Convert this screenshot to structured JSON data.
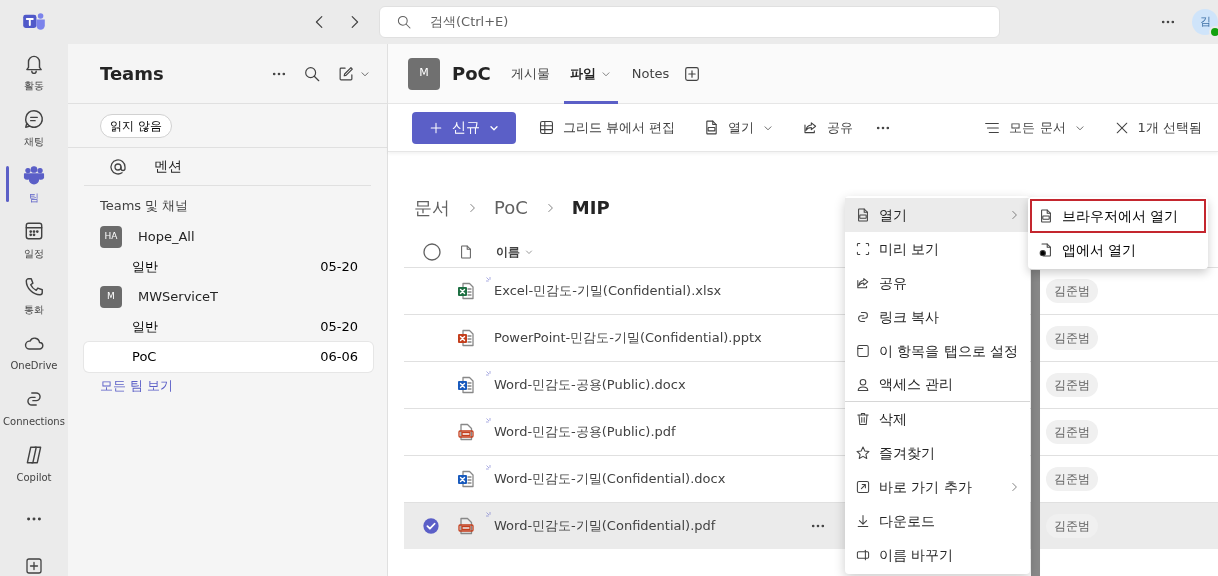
{
  "app_bar": {
    "search_placeholder": "검색(Ctrl+E)",
    "avatar_initial": "김",
    "avatar_online": true
  },
  "rail": [
    {
      "kind": "bell",
      "label": "활동",
      "selected": false
    },
    {
      "kind": "chat",
      "label": "채팅",
      "selected": false
    },
    {
      "kind": "teams",
      "label": "팀",
      "selected": true
    },
    {
      "kind": "calendar",
      "label": "일정",
      "selected": false
    },
    {
      "kind": "phone",
      "label": "통화",
      "selected": false
    },
    {
      "kind": "cloud",
      "label": "OneDrive",
      "selected": false
    },
    {
      "kind": "link",
      "label": "Connections",
      "selected": false
    },
    {
      "kind": "copilot",
      "label": "Copilot",
      "selected": false
    }
  ],
  "teams_panel": {
    "title": "Teams",
    "filter": "읽지 않음",
    "mention": "멘션",
    "section": "Teams 및 채널",
    "teams": [
      {
        "initials": "HA",
        "name": "Hope_All",
        "channels": [
          {
            "name": "일반",
            "date": "05-20",
            "selected": false
          }
        ]
      },
      {
        "initials": "M",
        "name": "MWServiceT",
        "channels": [
          {
            "name": "일반",
            "date": "05-20",
            "selected": false
          },
          {
            "name": "PoC",
            "date": "06-06",
            "selected": true
          }
        ]
      }
    ],
    "see_all": "모든 팀 보기"
  },
  "channel_header": {
    "avatar": "M",
    "name": "PoC",
    "tabs": [
      {
        "label": "게시물",
        "selected": false,
        "dropdown": false
      },
      {
        "label": "파일",
        "selected": true,
        "dropdown": true
      },
      {
        "label": "Notes",
        "selected": false,
        "dropdown": false
      }
    ]
  },
  "toolbar": {
    "new_button": "신규",
    "actions": [
      {
        "kind": "grid",
        "label": "그리드 뷰에서 편집",
        "dropdown": false
      },
      {
        "kind": "file",
        "label": "열기",
        "dropdown": true
      },
      {
        "kind": "share",
        "label": "공유",
        "dropdown": false
      }
    ],
    "view": "모든 문서",
    "selection": "1개 선택됨"
  },
  "breadcrumb": [
    "문서",
    "PoC",
    "MIP"
  ],
  "table": {
    "all_selected": false,
    "name_column": "이름",
    "rows": [
      {
        "kind": "xlsx",
        "name": "Excel-민감도-기밀(Confidential).xlsx",
        "new": true,
        "selected": false,
        "modified_by": "김준범"
      },
      {
        "kind": "pptx",
        "name": "PowerPoint-민감도-기밀(Confidential).pptx",
        "new": false,
        "selected": false,
        "modified_by": "김준범"
      },
      {
        "kind": "docx",
        "name": "Word-민감도-공용(Public).docx",
        "new": true,
        "selected": false,
        "modified_by": "김준범"
      },
      {
        "kind": "pdf",
        "name": "Word-민감도-공용(Public).pdf",
        "new": true,
        "selected": false,
        "modified_by": "김준범"
      },
      {
        "kind": "docx",
        "name": "Word-민감도-기밀(Confidential).docx",
        "new": true,
        "selected": false,
        "modified_by": "김준범"
      },
      {
        "kind": "pdf",
        "name": "Word-민감도-기밀(Confidential).pdf",
        "new": true,
        "selected": true,
        "modified_by": "김준범"
      }
    ]
  },
  "context_menu": {
    "items": [
      {
        "kind": "file",
        "label": "열기",
        "submenu": true,
        "highlighted": true,
        "separator_after": false
      },
      {
        "kind": "preview",
        "label": "미리 보기",
        "submenu": false,
        "highlighted": false,
        "separator_after": false
      },
      {
        "kind": "share",
        "label": "공유",
        "submenu": false,
        "highlighted": false,
        "separator_after": false
      },
      {
        "kind": "link",
        "label": "링크 복사",
        "submenu": false,
        "highlighted": false,
        "separator_after": false
      },
      {
        "kind": "tab",
        "label": "이 항목을 탭으로 설정",
        "submenu": false,
        "highlighted": false,
        "separator_after": false
      },
      {
        "kind": "person",
        "label": "액세스 관리",
        "submenu": false,
        "highlighted": false,
        "separator_after": true
      },
      {
        "kind": "trash",
        "label": "삭제",
        "submenu": false,
        "highlighted": false,
        "separator_after": false
      },
      {
        "kind": "star",
        "label": "즐겨찾기",
        "submenu": false,
        "highlighted": false,
        "separator_after": false
      },
      {
        "kind": "shortcut",
        "label": "바로 가기 추가",
        "submenu": true,
        "highlighted": false,
        "separator_after": false
      },
      {
        "kind": "download",
        "label": "다운로드",
        "submenu": false,
        "highlighted": false,
        "separator_after": false
      },
      {
        "kind": "rename",
        "label": "이름 바꾸기",
        "submenu": false,
        "highlighted": false,
        "separator_after": false
      }
    ],
    "submenu": [
      {
        "kind": "file",
        "label": "브라우저에서 열기",
        "highlighted": true
      },
      {
        "kind": "app",
        "label": "앱에서 열기",
        "highlighted": false
      }
    ]
  }
}
